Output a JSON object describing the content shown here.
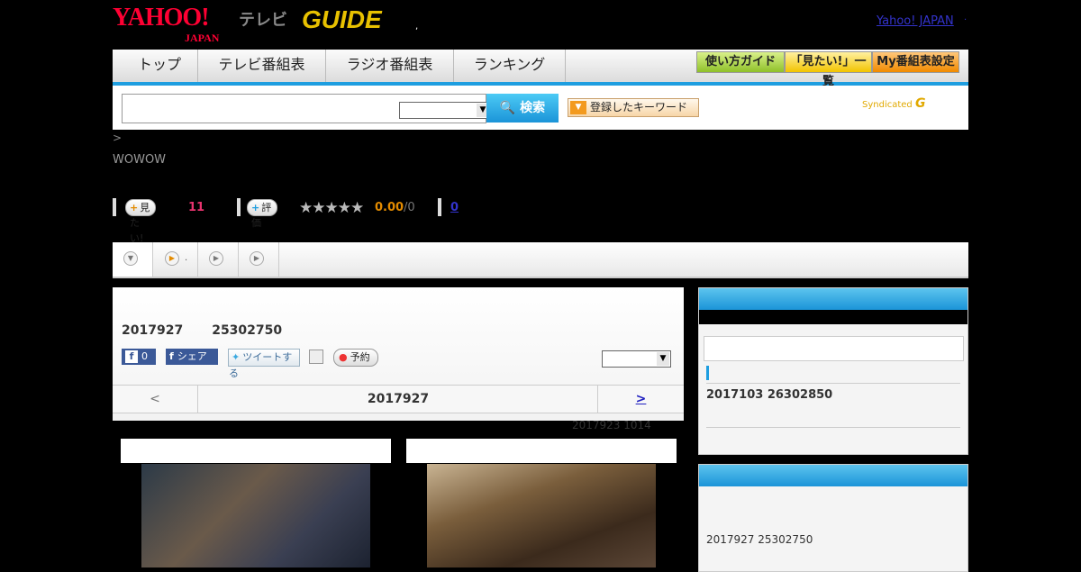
{
  "header": {
    "yahoo_logo": "YAHOO!",
    "yahoo_logo_sub": "JAPAN",
    "tv_label": "テレビ",
    "gguide_logo": "GUIDE",
    "yahoo_japan_link": "Yahoo! JAPAN",
    "dot_mark": ",",
    "dot_mark2": "."
  },
  "nav": {
    "tabs": [
      "トップ",
      "テレビ番組表",
      "ラジオ番組表",
      "ランキング"
    ],
    "buttons": [
      "使い方ガイド",
      "「見たい!」一覧",
      "My番組表設定"
    ],
    "accent": "#1e9ee0"
  },
  "search": {
    "input_value": "",
    "select_value": "",
    "search_button": "検索",
    "keyword_button": "登録したキーワード",
    "syndicated_label": "Syndicated",
    "syndicated_logo": "G"
  },
  "breadcrumb": ">",
  "station": "WOWOW",
  "stats": {
    "want_label": "見たい!",
    "want_count": "11",
    "rate_label": "評価",
    "stars": "★★★★★",
    "rating_value": "0.00",
    "rating_total": "/0",
    "review_link": "0"
  },
  "content_tabs": {
    "tab2_suffix": "."
  },
  "main": {
    "date": "2017927",
    "time_code": "25302750",
    "fb_count": "0",
    "fb_share": "シェア",
    "tweet": "ツイートする",
    "reserve": "予約",
    "select_value": "",
    "pager_prev": "<",
    "pager_current": "2017927",
    "pager_next": ">",
    "note": "2017923  1014"
  },
  "sidebar": {
    "box1_entry": "2017103  26302850",
    "box2_entry": "2017927  25302750"
  }
}
